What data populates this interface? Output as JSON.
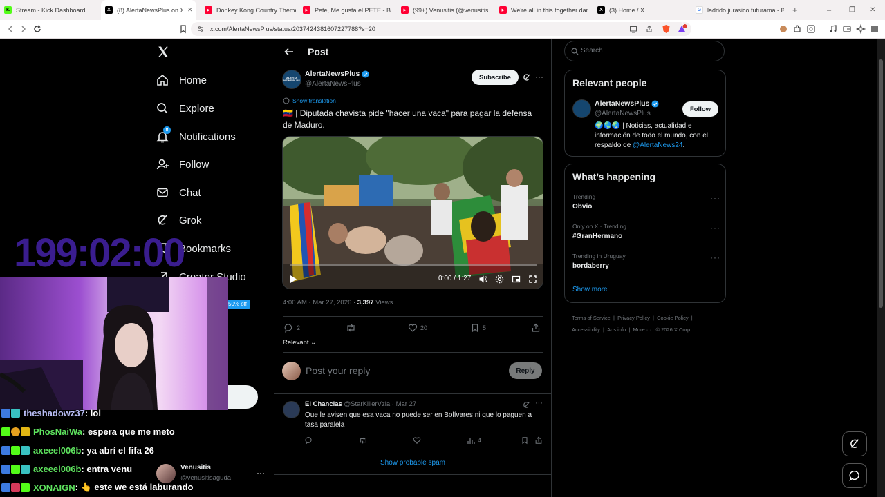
{
  "browser": {
    "tabs": [
      {
        "title": "Stream - Kick Dashboard",
        "fav_color": "#53fc18",
        "fav": "K"
      },
      {
        "title": "(8) AlertaNewsPlus on X: \"",
        "fav_color": "#000000",
        "fav": "X",
        "active": true
      },
      {
        "title": "Donkey Kong Country Theme",
        "fav_color": "#ff0033",
        "fav": "▶"
      },
      {
        "title": "Pete, Me gusta el PETE - Billike",
        "fav_color": "#ff0033",
        "fav": "▶"
      },
      {
        "title": "(99+) Venusitis (@venusitiss) |",
        "fav_color": "#ff0033",
        "fav": "▶"
      },
      {
        "title": "We're all in this together dance",
        "fav_color": "#ff0033",
        "fav": "▶"
      },
      {
        "title": "(3) Home / X",
        "fav_color": "#000000",
        "fav": "X"
      },
      {
        "title": "ladrido jurasico futurama - Bus",
        "fav_color": "#4285f4",
        "fav": "G"
      }
    ],
    "url": "x.com/AlertaNewsPlus/status/2037424381607227788?s=20",
    "shield_badge": "0"
  },
  "nav": {
    "logo": "X",
    "items": [
      {
        "label": "Home",
        "icon": "home-icon"
      },
      {
        "label": "Explore",
        "icon": "search-icon"
      },
      {
        "label": "Notifications",
        "icon": "bell-icon",
        "badge": "8"
      },
      {
        "label": "Follow",
        "icon": "follow-icon"
      },
      {
        "label": "Chat",
        "icon": "mail-icon"
      },
      {
        "label": "Grok",
        "icon": "grok-icon"
      },
      {
        "label": "Bookmarks",
        "icon": "bookmark-icon"
      },
      {
        "label": "Creator Studio",
        "icon": "creator-icon"
      }
    ],
    "premium_badge": "50% off"
  },
  "post": {
    "header_title": "Post",
    "author_name": "AlertaNewsPlus",
    "author_handle": "@AlertaNewsPlus",
    "avatar_text": "ALERTA NEWS PLUS",
    "subscribe_label": "Subscribe",
    "show_translation": "Show translation",
    "text": "🇻🇪 | Diputada chavista pide \"hacer una vaca\" para pagar la defensa de Maduro.",
    "video_time": "0:00 / 1:27",
    "video_progress": 0,
    "timestamp": "4:00 AM · Mar 27, 2026 · ",
    "views_count": "3,397",
    "views_label": " Views",
    "replies": "2",
    "likes": "20",
    "bookmarks": "5",
    "relevant_label": "Relevant",
    "reply_placeholder": "Post your reply",
    "reply_button": "Reply"
  },
  "reply": {
    "name": "El Chanclas",
    "meta": "@StarKillerVzla · Mar 27",
    "text": "Que le avisen que esa vaca no puede ser en Bolívares ni que lo paguen a tasa paralela",
    "views": "4"
  },
  "show_spam": "Show probable spam",
  "search": {
    "placeholder": "Search"
  },
  "relevant_people": {
    "title": "Relevant people",
    "name": "AlertaNewsPlus",
    "handle": "@AlertaNewsPlus",
    "follow_label": "Follow",
    "bio_prefix": "🌍🌎🌏 | Noticias, actualidad e información de todo el mundo, con el respaldo de ",
    "bio_link": "@AlertaNews24",
    "bio_suffix": "."
  },
  "happening": {
    "title": "What’s happening",
    "trends": [
      {
        "category": "Trending",
        "name": "Obvio"
      },
      {
        "category": "Only on X · Trending",
        "name": "#GranHermano"
      },
      {
        "category": "Trending in Uruguay",
        "name": "bordaberry"
      }
    ],
    "show_more": "Show more"
  },
  "footer_links": [
    "Terms of Service",
    "Privacy Policy",
    "Cookie Policy",
    "Accessibility",
    "Ads info",
    "More ···",
    "© 2026 X Corp."
  ],
  "overlay": {
    "timer": "199:02:00",
    "account_name": "Venusitis",
    "account_handle": "@venusitisaguda",
    "chat": [
      {
        "user": "theshadowz37",
        "user_color": "#b8bdf5",
        "msg": " : lol"
      },
      {
        "user": "PhosNaiWa",
        "user_color": "#5ee35e",
        "msg": " : espera que me meto"
      },
      {
        "user": "axeeel006b",
        "user_color": "#5ee35e",
        "msg": " : ya abrí el fifa 26"
      },
      {
        "user": "axeeel006b",
        "user_color": "#5ee35e",
        "msg": " : entra venu"
      },
      {
        "user": "XONAIGN",
        "user_color": "#5ee35e",
        "msg": " : 👆 este we está laburando"
      }
    ]
  },
  "colors": {
    "accent": "#1d9bf0",
    "bg": "#000000",
    "border": "#2f3336",
    "muted": "#71767b"
  }
}
